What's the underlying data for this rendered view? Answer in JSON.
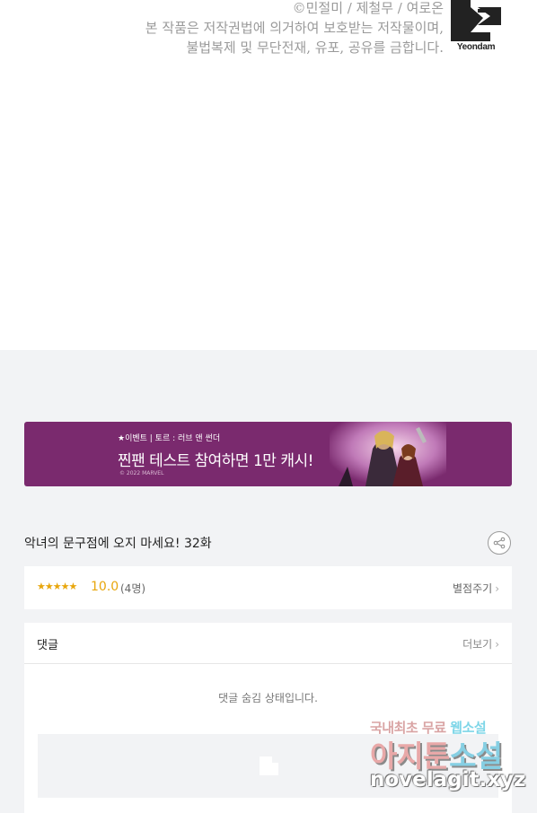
{
  "copyright": {
    "line1": "©민절미 / 제철무 / 여로온",
    "line2": "본 작품은 저작권법에 의거하여 보호받는 저작물이며,",
    "line3": "불법복제 및 무단전재, 유포, 공유를 금합니다.",
    "logo_text": "Yeondam"
  },
  "banner": {
    "event_label": "★이벤트 | 토르 : 러브 앤 썬더",
    "headline": "찐팬 테스트 참여하면 1만 캐시!",
    "copyright": "© 2022 MARVEL"
  },
  "episode": {
    "title": "악녀의 문구점에 오지 마세요! 32화"
  },
  "rating": {
    "stars": "★★★★★",
    "score": "10.0",
    "count": "(4명)",
    "rate_label": "별점주기"
  },
  "comments": {
    "title": "댓글",
    "more_label": "더보기",
    "hidden_message": "댓글 숨김 상태입니다."
  },
  "watermark": {
    "top_prefix": "국내최초 무료",
    "top_highlight": "웹소설",
    "main_prefix": "아지툰",
    "main_highlight": "소설",
    "url": "novelagit.xyz"
  },
  "icons": {
    "share": "share-icon",
    "chevron": "chevron-right-icon",
    "compose": "compose-icon"
  },
  "colors": {
    "banner_bg": "#7a2a6e",
    "star": "#e8a60c",
    "page_gray": "#f2f3f5"
  }
}
